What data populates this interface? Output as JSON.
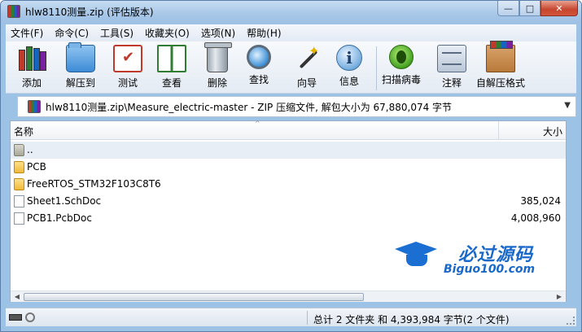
{
  "window": {
    "title": "hlw8110测量.zip (评估版本)",
    "controls": {
      "minimize": "—",
      "maximize": "□",
      "close": "✕"
    }
  },
  "menu": [
    "文件(F)",
    "命令(C)",
    "工具(S)",
    "收藏夹(O)",
    "选项(N)",
    "帮助(H)"
  ],
  "toolbar": [
    {
      "label": "添加",
      "icon": "add-archive-icon"
    },
    {
      "label": "解压到",
      "icon": "extract-to-icon"
    },
    {
      "label": "测试",
      "icon": "test-icon"
    },
    {
      "label": "查看",
      "icon": "view-icon"
    },
    {
      "label": "删除",
      "icon": "delete-icon"
    },
    {
      "label": "查找",
      "icon": "find-icon"
    },
    {
      "label": "向导",
      "icon": "wizard-icon"
    },
    {
      "label": "信息",
      "icon": "info-icon"
    },
    {
      "label": "扫描病毒",
      "icon": "virus-scan-icon"
    },
    {
      "label": "注释",
      "icon": "comment-icon"
    },
    {
      "label": "自解压格式",
      "icon": "sfx-icon"
    }
  ],
  "address": {
    "path": "hlw8110测量.zip\\Measure_electric-master - ZIP 压缩文件, 解包大小为 67,880,074 字节",
    "dropdown": "▼"
  },
  "list": {
    "columns": {
      "name": "名称",
      "size": "大小"
    },
    "sort_indicator": "^",
    "rows": [
      {
        "name": "..",
        "size": "",
        "type": "up"
      },
      {
        "name": "PCB",
        "size": "",
        "type": "folder"
      },
      {
        "name": "FreeRTOS_STM32F103C8T6",
        "size": "",
        "type": "folder"
      },
      {
        "name": "Sheet1.SchDoc",
        "size": "385,024",
        "type": "file"
      },
      {
        "name": "PCB1.PcbDoc",
        "size": "4,008,960",
        "type": "file"
      }
    ]
  },
  "scrollbar": {
    "left": "◀",
    "right": "▶"
  },
  "watermark": {
    "title": "必过源码",
    "subtitle": "Biguo100.com"
  },
  "status": {
    "summary": "总计 2 文件夹 和 4,393,984 字节(2 个文件)"
  },
  "colors": {
    "accent": "#1a68c8",
    "title_bar": "#a9c8e8",
    "folder": "#f0b93a"
  }
}
